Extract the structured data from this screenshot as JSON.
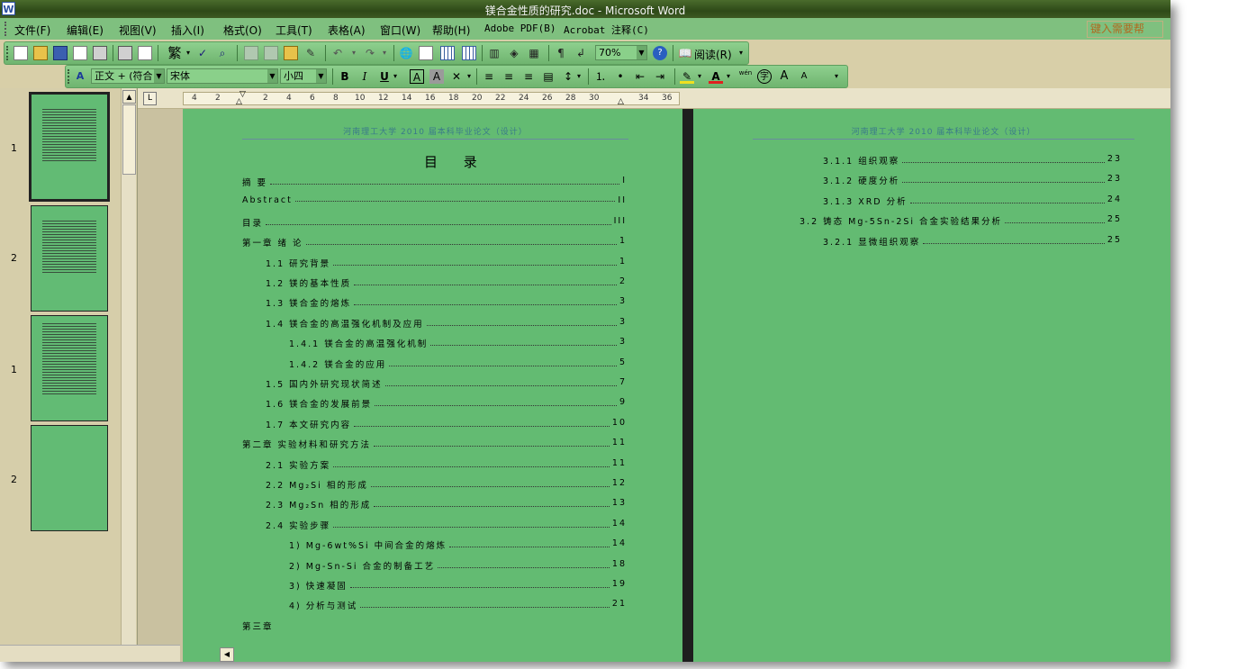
{
  "window": {
    "title": "镁合金性质的研究.doc - Microsoft Word",
    "app_icon": "W"
  },
  "menu": {
    "items": [
      "文件(F)",
      "编辑(E)",
      "视图(V)",
      "插入(I)",
      "格式(O)",
      "工具(T)",
      "表格(A)",
      "窗口(W)",
      "帮助(H)",
      "Adobe PDF(B)",
      "Acrobat 注释(C)"
    ],
    "help_placeholder": "键入需要帮"
  },
  "standard_toolbar": {
    "traditional_label": "繁",
    "zoom": "70%",
    "read_label": "阅读(R)"
  },
  "format_toolbar": {
    "style": "正文 + (符合",
    "font": "宋体",
    "size": "小四",
    "bold": "B",
    "italic": "I",
    "underline": "U",
    "char_border": "A",
    "char_shade": "A",
    "font_color": "A",
    "phonetic": "wén",
    "encircle": "字",
    "grow_font": "A",
    "shrink_font": "A"
  },
  "ruler": {
    "corner": "L",
    "ticks": [
      "4",
      "2",
      "2",
      "4",
      "6",
      "8",
      "10",
      "12",
      "14",
      "16",
      "18",
      "20",
      "22",
      "24",
      "26",
      "28",
      "30",
      "34",
      "36"
    ]
  },
  "thumbnails": [
    {
      "label": "1",
      "selected": true
    },
    {
      "label": "2",
      "selected": false
    },
    {
      "label": "1",
      "selected": false
    },
    {
      "label": "2",
      "selected": false
    }
  ],
  "left_page": {
    "header": "河南理工大学 2010 届本科毕业论文（设计）",
    "title": "目  录",
    "entries": [
      {
        "text": "摘    要",
        "page": "I",
        "indent": 0
      },
      {
        "text": "Abstract",
        "page": "II",
        "indent": 0
      },
      {
        "text": "目录",
        "page": "III",
        "indent": 0
      },
      {
        "text": "第一章   绪  论",
        "page": "1",
        "indent": 0
      },
      {
        "text": "1.1  研究背景",
        "page": "1",
        "indent": 1
      },
      {
        "text": "1.2  镁的基本性质",
        "page": "2",
        "indent": 1
      },
      {
        "text": "1.3   镁合金的熔炼",
        "page": "3",
        "indent": 1
      },
      {
        "text": "1.4   镁合金的高温强化机制及应用",
        "page": "3",
        "indent": 1
      },
      {
        "text": "1.4.1 镁合金的高温强化机制",
        "page": "3",
        "indent": 2
      },
      {
        "text": "1.4.2  镁合金的应用",
        "page": "5",
        "indent": 2
      },
      {
        "text": "1.5   国内外研究现状简述",
        "page": "7",
        "indent": 1
      },
      {
        "text": "1.6  镁合金的发展前景",
        "page": "9",
        "indent": 1
      },
      {
        "text": "1.7  本文研究内容",
        "page": "10",
        "indent": 1
      },
      {
        "text": "第二章    实验材料和研究方法",
        "page": "11",
        "indent": 0
      },
      {
        "text": "2.1   实验方案",
        "page": "11",
        "indent": 1
      },
      {
        "text": "2.2   Mg₂Si 相的形成",
        "page": "12",
        "indent": 1
      },
      {
        "text": "2.3   Mg₂Sn 相的形成",
        "page": "13",
        "indent": 1
      },
      {
        "text": "2.4   实验步骤",
        "page": "14",
        "indent": 1
      },
      {
        "text": "1)  Mg-6wt%Si 中间合金的熔炼",
        "page": "14",
        "indent": 2
      },
      {
        "text": "2)  Mg-Sn-Si 合金的制备工艺",
        "page": "18",
        "indent": 2
      },
      {
        "text": "3)  快速凝固",
        "page": "19",
        "indent": 2
      },
      {
        "text": "4)  分析与测试",
        "page": "21",
        "indent": 2
      },
      {
        "text": "第三章",
        "page": "",
        "indent": 0
      }
    ]
  },
  "right_page": {
    "header": "河南理工大学 2010 届本科毕业论文（设计）",
    "entries": [
      {
        "text": "3.1.1  组织观察",
        "page": "23",
        "indent": 2
      },
      {
        "text": "3.1.2  硬度分析",
        "page": "23",
        "indent": 2
      },
      {
        "text": "3.1.3  XRD 分析",
        "page": "24",
        "indent": 2
      },
      {
        "text": "3.2  铸态 Mg-5Sn-2Si 合金实验结果分析",
        "page": "25",
        "indent": 1
      },
      {
        "text": "3.2.1   显微组织观察",
        "page": "25",
        "indent": 2
      }
    ]
  },
  "colors": {
    "page_bg": "#63bb72",
    "toolbar_bg": "#7fc07f",
    "title_bg": "#3d5a22"
  }
}
